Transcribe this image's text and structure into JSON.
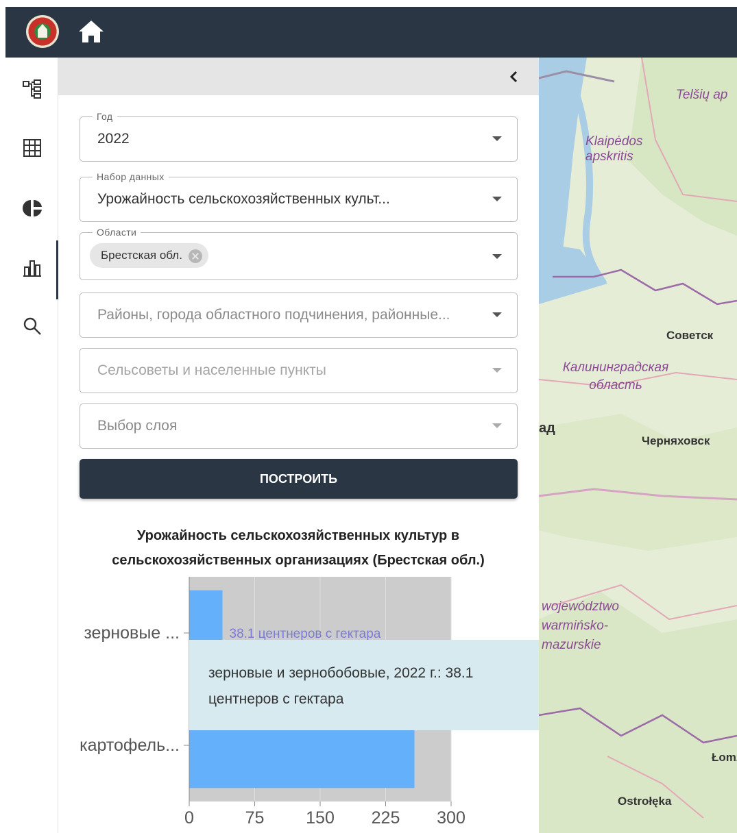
{
  "colors": {
    "header": "#2b3644",
    "accent": "#2b3644",
    "bar": "#64b0fa",
    "track": "#cccccc",
    "tooltip": "#d7eaf0"
  },
  "header": {
    "logo_icon": "emblem-logo",
    "home_icon": "home-icon"
  },
  "rail": {
    "items": [
      {
        "icon": "hierarchy-icon",
        "active": false
      },
      {
        "icon": "grid-icon",
        "active": false
      },
      {
        "icon": "pie-chart-icon",
        "active": false
      },
      {
        "icon": "bar-chart-icon",
        "active": true
      },
      {
        "icon": "search-icon",
        "active": false
      }
    ]
  },
  "panel": {
    "collapse_icon": "chevron-left-icon"
  },
  "form": {
    "year": {
      "legend": "Год",
      "value": "2022"
    },
    "dataset": {
      "legend": "Набор данных",
      "value": "Урожайность сельскохозяйственных культ..."
    },
    "regions": {
      "legend": "Области",
      "chip": "Брестская обл."
    },
    "districts": {
      "placeholder": "Районы, города областного подчинения, районные..."
    },
    "councils": {
      "placeholder": "Сельсоветы и населенные пункты"
    },
    "layer": {
      "placeholder": "Выбор слоя"
    },
    "build_label": "ПОСТРОИТЬ"
  },
  "chart_data": {
    "type": "bar",
    "orientation": "horizontal",
    "title": "Урожайность сельскохозяйственных культур в сельскохозяйственных организациях (Брестская обл.)",
    "categories": [
      "зерновые ...",
      "картофель..."
    ],
    "values": [
      38.1,
      258
    ],
    "xlim": [
      0,
      300
    ],
    "xticks": [
      0,
      75,
      150,
      225,
      300
    ],
    "data_labels": [
      "38.1 центнеров с гектара",
      ""
    ]
  },
  "tooltip": {
    "text": "зерновые и зернобобовые, 2022 г.: 38.1 центнеров с гектара"
  },
  "map": {
    "labels": [
      "Telšių ap",
      "Klaipėdos apskritis",
      "Советск",
      "Калининградская область",
      "ад",
      "Черняховск",
      "województwo warmińsko-mazurskie",
      "Łomż",
      "Ostrołęka"
    ]
  }
}
